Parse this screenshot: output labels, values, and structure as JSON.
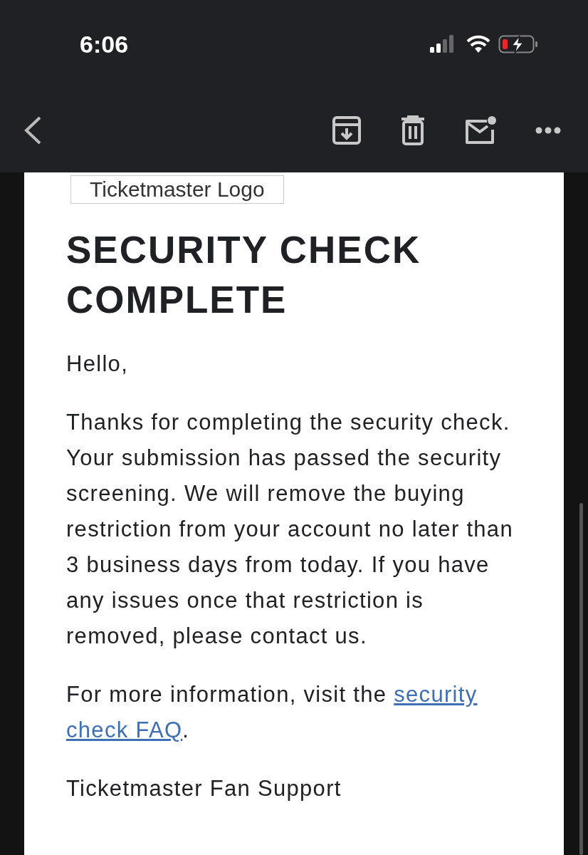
{
  "status_bar": {
    "time": "6:06"
  },
  "email": {
    "logo_alt": "Ticketmaster Logo",
    "heading": "SECURITY CHECK COMPLETE",
    "greeting": "Hello,",
    "body": "Thanks for completing the security check. Your submission has passed the security screening. We will remove the buying restriction from your account no later than 3 business days from today. If you have any issues once that restriction is removed, please contact us.",
    "info": {
      "text_before": "For more information, visit the ",
      "link": "security check FAQ",
      "text_after": "."
    },
    "signature": "Ticketmaster Fan Support"
  }
}
